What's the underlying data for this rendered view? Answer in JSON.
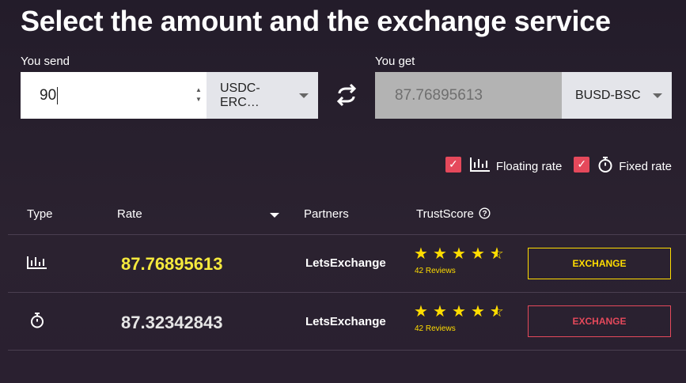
{
  "title": "Select the amount and the exchange service",
  "send": {
    "label": "You send",
    "amount": "90",
    "currency": "USDC-ERC…"
  },
  "get": {
    "label": "You get",
    "amount": "87.76895613",
    "currency": "BUSD-BSC"
  },
  "filters": {
    "floating_label": "Floating rate",
    "fixed_label": "Fixed rate",
    "floating_checked": true,
    "fixed_checked": true
  },
  "table": {
    "headers": {
      "type": "Type",
      "rate": "Rate",
      "partners": "Partners",
      "trustscore": "TrustScore"
    },
    "rows": [
      {
        "type_icon": "bar-chart-icon",
        "rate": "87.76895613",
        "partner": "LetsExchange",
        "stars": 4.5,
        "reviews": "42 Reviews",
        "button": "EXCHANGE"
      },
      {
        "type_icon": "stopwatch-icon",
        "rate": "87.32342843",
        "partner": "LetsExchange",
        "stars": 4.5,
        "reviews": "42 Reviews",
        "button": "EXCHANGE"
      }
    ]
  },
  "colors": {
    "accent_yellow": "#ffdd00",
    "accent_red": "#e5495b",
    "rate_yellow": "#f5e93d"
  }
}
